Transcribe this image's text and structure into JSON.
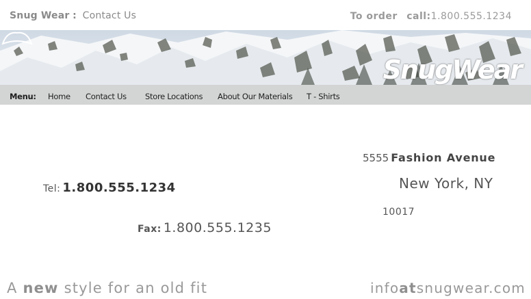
{
  "header": {
    "brand": "Snug Wear",
    "brand_sep": ":",
    "page_title": "Contact Us",
    "order_label": "To order",
    "call_label": "call:",
    "order_phone": "1.800.555.1234"
  },
  "banner": {
    "logo_text": "SnugWear",
    "menu_label": "Menu:",
    "menu_items": [
      "Home",
      "Contact Us",
      "Store Locations",
      "About Our Materials",
      "T - Shirts"
    ]
  },
  "contact": {
    "street_number": "5555",
    "street_name": "Fashion Avenue",
    "city_state": "New York, NY",
    "zip": "10017",
    "tel_label": "Tel:",
    "tel_value": "1.800.555.1234",
    "fax_label": "Fax:",
    "fax_value": "1.800.555.1235"
  },
  "footer": {
    "tagline_pre": "A",
    "tagline_bold": "new",
    "tagline_post": "style for an old fit",
    "email_pre": "info",
    "email_bold": "at",
    "email_post": "snugwear.com"
  }
}
